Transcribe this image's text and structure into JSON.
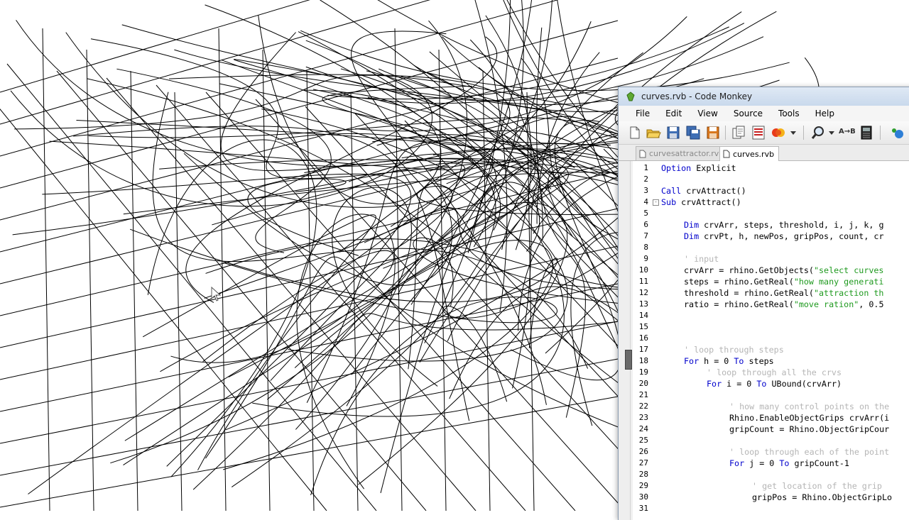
{
  "window": {
    "title": "curves.rvb - Code Monkey"
  },
  "menu": {
    "items": [
      "File",
      "Edit",
      "View",
      "Source",
      "Tools",
      "Help"
    ]
  },
  "toolbar": {
    "buttons": [
      "new-file-icon",
      "open-folder-icon",
      "save-icon",
      "save-all-icon",
      "save-as-icon",
      "copy-document-icon",
      "list-icon",
      "run-script-icon",
      "run-dropdown-icon",
      "find-icon",
      "find-dropdown-icon",
      "replace-icon",
      "calculator-icon",
      "plugin-icon"
    ],
    "replace_text": "A→B",
    "calc_text": "06"
  },
  "tabs": [
    {
      "label": "curvesattractor.rvb",
      "active": false
    },
    {
      "label": "curves.rvb",
      "active": true
    }
  ],
  "code": {
    "lines": [
      {
        "n": "1",
        "indent": 0,
        "tokens": [
          [
            "kw",
            "Option"
          ],
          [
            "t",
            " Explicit"
          ]
        ]
      },
      {
        "n": "2",
        "indent": 0,
        "tokens": []
      },
      {
        "n": "3",
        "indent": 0,
        "tokens": [
          [
            "kw",
            "Call"
          ],
          [
            "t",
            " crvAttract()"
          ]
        ]
      },
      {
        "n": "4",
        "indent": 0,
        "fold": "-",
        "tokens": [
          [
            "kw",
            "Sub"
          ],
          [
            "t",
            " crvAttract()"
          ]
        ]
      },
      {
        "n": "5",
        "indent": 0,
        "tokens": []
      },
      {
        "n": "6",
        "indent": 4,
        "tokens": [
          [
            "kw",
            "Dim"
          ],
          [
            "t",
            " crvArr, steps, threshold, i, j, k, g"
          ]
        ]
      },
      {
        "n": "7",
        "indent": 4,
        "tokens": [
          [
            "kw",
            "Dim"
          ],
          [
            "t",
            " crvPt, h, newPos, gripPos, count, cr"
          ]
        ]
      },
      {
        "n": "8",
        "indent": 0,
        "tokens": []
      },
      {
        "n": "9",
        "indent": 4,
        "tokens": [
          [
            "cm",
            "' input"
          ]
        ]
      },
      {
        "n": "10",
        "indent": 4,
        "tokens": [
          [
            "t",
            "crvArr = rhino.GetObjects("
          ],
          [
            "str",
            "\"select curves"
          ]
        ]
      },
      {
        "n": "11",
        "indent": 4,
        "tokens": [
          [
            "t",
            "steps = rhino.GetReal("
          ],
          [
            "str",
            "\"how many generati"
          ]
        ]
      },
      {
        "n": "12",
        "indent": 4,
        "tokens": [
          [
            "t",
            "threshold = rhino.GetReal("
          ],
          [
            "str",
            "\"attraction th"
          ]
        ]
      },
      {
        "n": "13",
        "indent": 4,
        "tokens": [
          [
            "t",
            "ratio = rhino.GetReal("
          ],
          [
            "str",
            "\"move ration\""
          ],
          [
            "t",
            ", 0.5"
          ]
        ]
      },
      {
        "n": "14",
        "indent": 0,
        "tokens": []
      },
      {
        "n": "15",
        "indent": 0,
        "tokens": []
      },
      {
        "n": "16",
        "indent": 0,
        "tokens": []
      },
      {
        "n": "17",
        "indent": 4,
        "tokens": [
          [
            "cm",
            "' loop through steps"
          ]
        ]
      },
      {
        "n": "18",
        "indent": 4,
        "tokens": [
          [
            "kw",
            "For"
          ],
          [
            "t",
            " h = 0 "
          ],
          [
            "kw",
            "To"
          ],
          [
            "t",
            " steps"
          ]
        ]
      },
      {
        "n": "19",
        "indent": 8,
        "tokens": [
          [
            "cm",
            "' loop through all the crvs"
          ]
        ]
      },
      {
        "n": "20",
        "indent": 8,
        "tokens": [
          [
            "kw",
            "For"
          ],
          [
            "t",
            " i = 0 "
          ],
          [
            "kw",
            "To"
          ],
          [
            "t",
            " UBound(crvArr)"
          ]
        ]
      },
      {
        "n": "21",
        "indent": 0,
        "tokens": []
      },
      {
        "n": "22",
        "indent": 12,
        "tokens": [
          [
            "cm",
            "' how many control points on the"
          ]
        ]
      },
      {
        "n": "23",
        "indent": 12,
        "tokens": [
          [
            "t",
            "Rhino.EnableObjectGrips crvArr(i"
          ]
        ]
      },
      {
        "n": "24",
        "indent": 12,
        "tokens": [
          [
            "t",
            "gripCount = Rhino.ObjectGripCour"
          ]
        ]
      },
      {
        "n": "25",
        "indent": 0,
        "tokens": []
      },
      {
        "n": "26",
        "indent": 12,
        "tokens": [
          [
            "cm",
            "' loop through each of the point"
          ]
        ]
      },
      {
        "n": "27",
        "indent": 12,
        "tokens": [
          [
            "kw",
            "For"
          ],
          [
            "t",
            " j = 0 "
          ],
          [
            "kw",
            "To"
          ],
          [
            "t",
            " gripCount-1"
          ]
        ]
      },
      {
        "n": "28",
        "indent": 0,
        "tokens": []
      },
      {
        "n": "29",
        "indent": 16,
        "tokens": [
          [
            "cm",
            "' get location of the grip"
          ]
        ]
      },
      {
        "n": "30",
        "indent": 16,
        "tokens": [
          [
            "t",
            "gripPos = Rhino.ObjectGripLo"
          ]
        ]
      },
      {
        "n": "31",
        "indent": 0,
        "tokens": []
      }
    ]
  },
  "colors": {
    "keyword": "#0000cc",
    "string": "#1f9a1f",
    "comment": "#b5b5b5"
  }
}
